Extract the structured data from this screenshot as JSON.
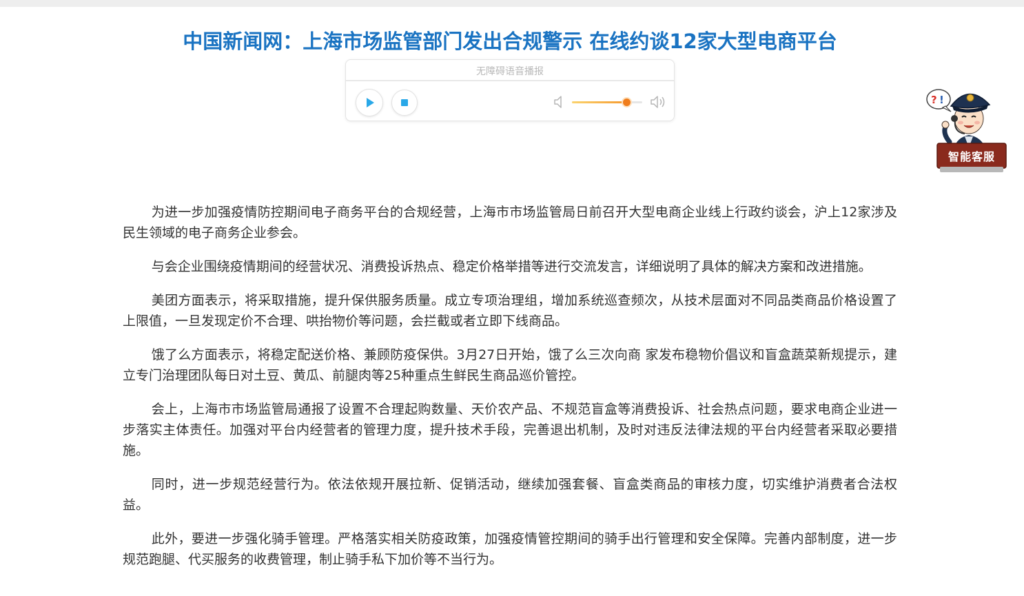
{
  "article": {
    "title": "中国新闻网：上海市场监管部门发出合规警示 在线约谈12家大型电商平台",
    "paragraphs": [
      "为进一步加强疫情防控期间电子商务平台的合规经营，上海市市场监管局日前召开大型电商企业线上行政约谈会，沪上12家涉及民生领域的电子商务企业参会。",
      "与会企业围绕疫情期间的经营状况、消费投诉热点、稳定价格举措等进行交流发言，详细说明了具体的解决方案和改进措施。",
      "美团方面表示，将采取措施，提升保供服务质量。成立专项治理组，增加系统巡查频次，从技术层面对不同品类商品价格设置了上限值，一旦发现定价不合理、哄抬物价等问题，会拦截或者立即下线商品。",
      "饿了么方面表示，将稳定配送价格、兼顾防疫保供。3月27日开始，饿了么三次向商 家发布稳物价倡议和盲盒蔬菜新规提示，建立专门治理团队每日对土豆、黄瓜、前腿肉等25种重点生鲜民生商品巡价管控。",
      "会上，上海市市场监管局通报了设置不合理起购数量、天价农产品、不规范盲盒等消费投诉、社会热点问题，要求电商企业进一步落实主体责任。加强对平台内经营者的管理力度，提升技术手段，完善退出机制，及时对违反法律法规的平台内经营者采取必要措施。",
      "同时，进一步规范经营行为。依法依规开展拉新、促销活动，继续加强套餐、盲盒类商品的审核力度，切实维护消费者合法权益。",
      "此外，要进一步强化骑手管理。严格落实相关防疫政策，加强疫情管控期间的骑手出行管理和安全保障。完善内部制度，进一步规范跑腿、代买服务的收费管理，制止骑手私下加价等不当行为。"
    ]
  },
  "audio_player": {
    "caption": "无障碍语音播报",
    "playback_progress": 0.0,
    "volume": 0.77,
    "icons": {
      "play": "play-icon",
      "stop": "stop-icon",
      "volume_low": "volume-low-icon",
      "volume_high": "volume-high-icon"
    }
  },
  "support_widget": {
    "label": "智能客服",
    "icon": "police-officer-mascot-icon"
  },
  "colors": {
    "title": "#1a73c2",
    "body_text": "#333333",
    "play_accent": "#29a8e8",
    "volume_accent": "#f07d1c",
    "support_label_bg": "#8a2a1d"
  }
}
